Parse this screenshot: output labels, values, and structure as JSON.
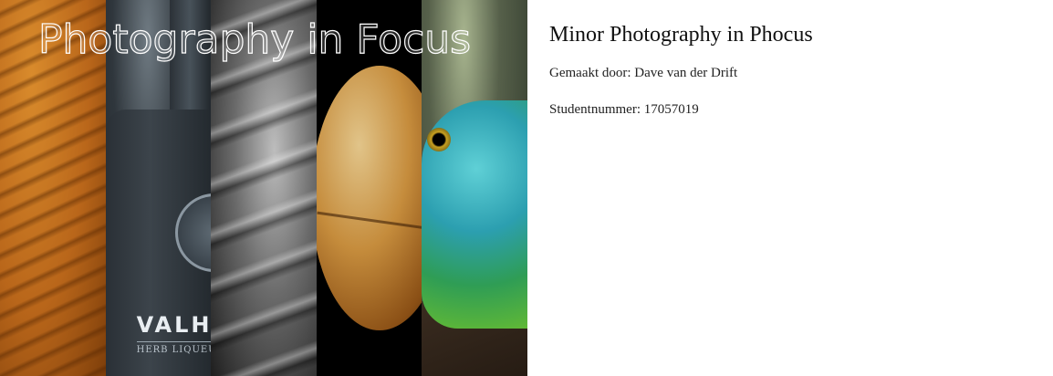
{
  "hero": {
    "title": "Photography in Focus",
    "strips": [
      {
        "name": "orange-fabric-photo",
        "color": "#c4701f"
      },
      {
        "name": "bottle-photo",
        "color": "#30373d",
        "brand_text": "VALH",
        "sub_text": "HERB LIQUEUR"
      },
      {
        "name": "hand-photo",
        "color": "#6b6b6b"
      },
      {
        "name": "fruit-photo",
        "color": "#c58c3c"
      },
      {
        "name": "lizard-photo",
        "color": "#2c9fb0"
      }
    ]
  },
  "info": {
    "title": "Minor Photography in Phocus",
    "author": "Gemaakt door: Dave van der Drift",
    "student_number": "Studentnummer: 17057019"
  }
}
